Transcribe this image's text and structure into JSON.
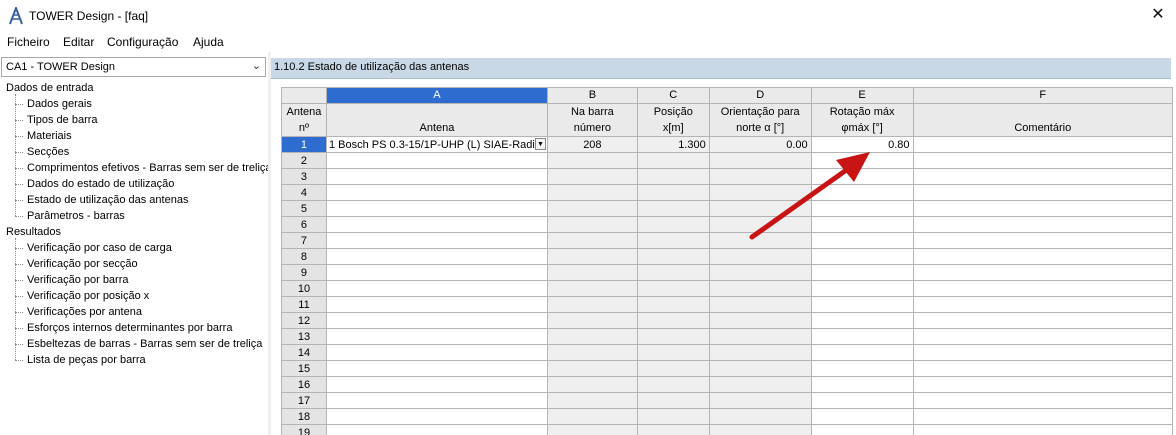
{
  "window": {
    "title": "TOWER Design - [faq]",
    "icon": "tower-app-icon",
    "close_icon": "close-icon"
  },
  "menu": [
    "Ficheiro",
    "Editar",
    "Configuração",
    "Ajuda"
  ],
  "left": {
    "case_selector": "CA1 - TOWER Design",
    "tree": [
      {
        "label": "Dados de entrada",
        "level": 0
      },
      {
        "label": "Dados gerais",
        "level": 1
      },
      {
        "label": "Tipos de barra",
        "level": 1
      },
      {
        "label": "Materiais",
        "level": 1
      },
      {
        "label": "Secções",
        "level": 1
      },
      {
        "label": "Comprimentos efetivos - Barras sem ser de treliça",
        "level": 1
      },
      {
        "label": "Dados do estado de utilização",
        "level": 1
      },
      {
        "label": "Estado de utilização das antenas",
        "level": 1
      },
      {
        "label": "Parâmetros - barras",
        "level": 1
      },
      {
        "label": "Resultados",
        "level": 0
      },
      {
        "label": "Verificação por caso de carga",
        "level": 1
      },
      {
        "label": "Verificação por secção",
        "level": 1
      },
      {
        "label": "Verificação por barra",
        "level": 1
      },
      {
        "label": "Verificação por posição x",
        "level": 1
      },
      {
        "label": "Verificações por antena",
        "level": 1
      },
      {
        "label": "Esforços internos determinantes por barra",
        "level": 1
      },
      {
        "label": "Esbeltezas de barras - Barras sem ser de treliça",
        "level": 1
      },
      {
        "label": "Lista de peças por barra",
        "level": 1
      }
    ]
  },
  "panel": {
    "title": "1.10.2 Estado de utilização das antenas"
  },
  "table": {
    "col_letters": [
      "A",
      "B",
      "C",
      "D",
      "E",
      "F"
    ],
    "row_header_title": [
      "Antena",
      "nº"
    ],
    "headers": [
      [
        "",
        "Antena"
      ],
      [
        "Na barra",
        "número"
      ],
      [
        "Posição",
        "x[m]"
      ],
      [
        "Orientação para",
        "norte α [°]"
      ],
      [
        "Rotação máx",
        "φmáx [°]"
      ],
      [
        "",
        "Comentário"
      ]
    ],
    "rows": [
      {
        "n": "1",
        "antena": "1 Bosch PS 0.3-15/1P-UHP (L) SIAE-Radi",
        "barra": "208",
        "posicao": "1.300",
        "orientacao": "0.00",
        "rotacao": "0.80",
        "comentario": ""
      },
      {
        "n": "2"
      },
      {
        "n": "3"
      },
      {
        "n": "4"
      },
      {
        "n": "5"
      },
      {
        "n": "6"
      },
      {
        "n": "7"
      },
      {
        "n": "8"
      },
      {
        "n": "9"
      },
      {
        "n": "10"
      },
      {
        "n": "11"
      },
      {
        "n": "12"
      },
      {
        "n": "13"
      },
      {
        "n": "14"
      },
      {
        "n": "15"
      },
      {
        "n": "16"
      },
      {
        "n": "17"
      },
      {
        "n": "18"
      },
      {
        "n": "19"
      }
    ]
  },
  "colors": {
    "selection": "#2f6cd0",
    "panel_header": "#c9d8e6",
    "arrow": "#c81414"
  }
}
